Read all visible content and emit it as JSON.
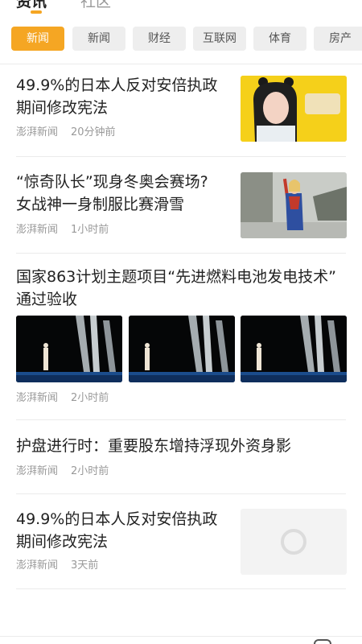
{
  "top_tabs": {
    "active": "资讯",
    "inactive": "社区"
  },
  "categories": [
    {
      "label": "新闻",
      "active": true
    },
    {
      "label": "新闻",
      "active": false
    },
    {
      "label": "财经",
      "active": false
    },
    {
      "label": "互联网",
      "active": false
    },
    {
      "label": "体育",
      "active": false
    },
    {
      "label": "房产",
      "active": false
    }
  ],
  "articles": [
    {
      "title_line1": "49.9%的日本人反对安倍执政",
      "title_line2": "期间修改宪法",
      "source": "澎湃新闻",
      "time": "20分钟前"
    },
    {
      "title_line1": "“惊奇队长”现身冬奥会赛场?",
      "title_line2": "女战神一身制服比赛滑雪",
      "source": "澎湃新闻",
      "time": "1小时前"
    },
    {
      "title_line1": "国家863计划主题项目“先进燃料电池发电技术”",
      "title_line2": "通过验收",
      "source": "澎湃新闻",
      "time": "2小时前"
    },
    {
      "title_line1": "护盘进行时：重要股东增持浮现外资身影",
      "source": "澎湃新闻",
      "time": "2小时前"
    },
    {
      "title_line1": "49.9%的日本人反对安倍执政",
      "title_line2": "期间修改宪法",
      "source": "澎湃新闻",
      "time": "3天前"
    }
  ],
  "colors": {
    "accent": "#f5a623",
    "chip_bg": "#eeeeee",
    "meta_text": "#999999",
    "title_text": "#222222"
  }
}
